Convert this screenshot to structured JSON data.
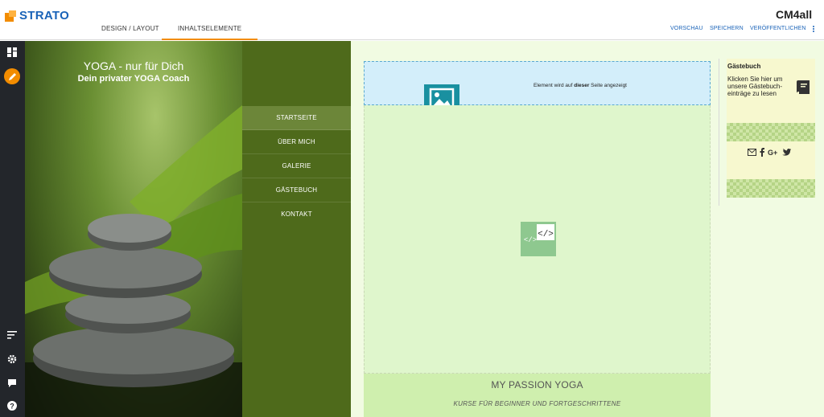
{
  "brand": {
    "name": "STRATO",
    "color": "#1a63b8",
    "accent": "#f28c00"
  },
  "main_tabs": [
    {
      "label": "DESIGN / LAYOUT",
      "active": false
    },
    {
      "label": "INHALTSELEMENTE",
      "active": true
    }
  ],
  "toolbar": {
    "preview": "VORSCHAU",
    "save": "SPEICHERN",
    "publish": "VERÖFFENTLICHEN"
  },
  "cm4all_logo": "CM4all",
  "sidebar": {
    "top": [
      "dashboard-icon",
      "pencil-icon"
    ],
    "bottom": [
      "sort-icon",
      "gear-icon",
      "chat-icon",
      "help-icon"
    ]
  },
  "hero": {
    "title": "YOGA - nur für Dich",
    "subtitle": "Dein privater YOGA Coach"
  },
  "nav": [
    {
      "label": "STARTSEITE",
      "active": true
    },
    {
      "label": "ÜBER MICH",
      "active": false
    },
    {
      "label": "GALERIE",
      "active": false
    },
    {
      "label": "GÄSTEBUCH",
      "active": false
    },
    {
      "label": "KONTAKT",
      "active": false
    }
  ],
  "banner": {
    "text_before": "Element wird auf ",
    "text_bold": "dieser",
    "text_after": " Seite angezeigt"
  },
  "guestbook": {
    "title": "Gästebuch",
    "text": "Klicken Sie hier um unsere Gästebuch-einträge zu lesen"
  },
  "social": [
    "envelope-icon",
    "facebook-icon",
    "google-plus-icon",
    "twitter-icon"
  ],
  "passion": {
    "title": "MY PASSION YOGA",
    "subtitle": "KURSE FÜR BEGINNER UND FORTGESCHRITTENE"
  }
}
